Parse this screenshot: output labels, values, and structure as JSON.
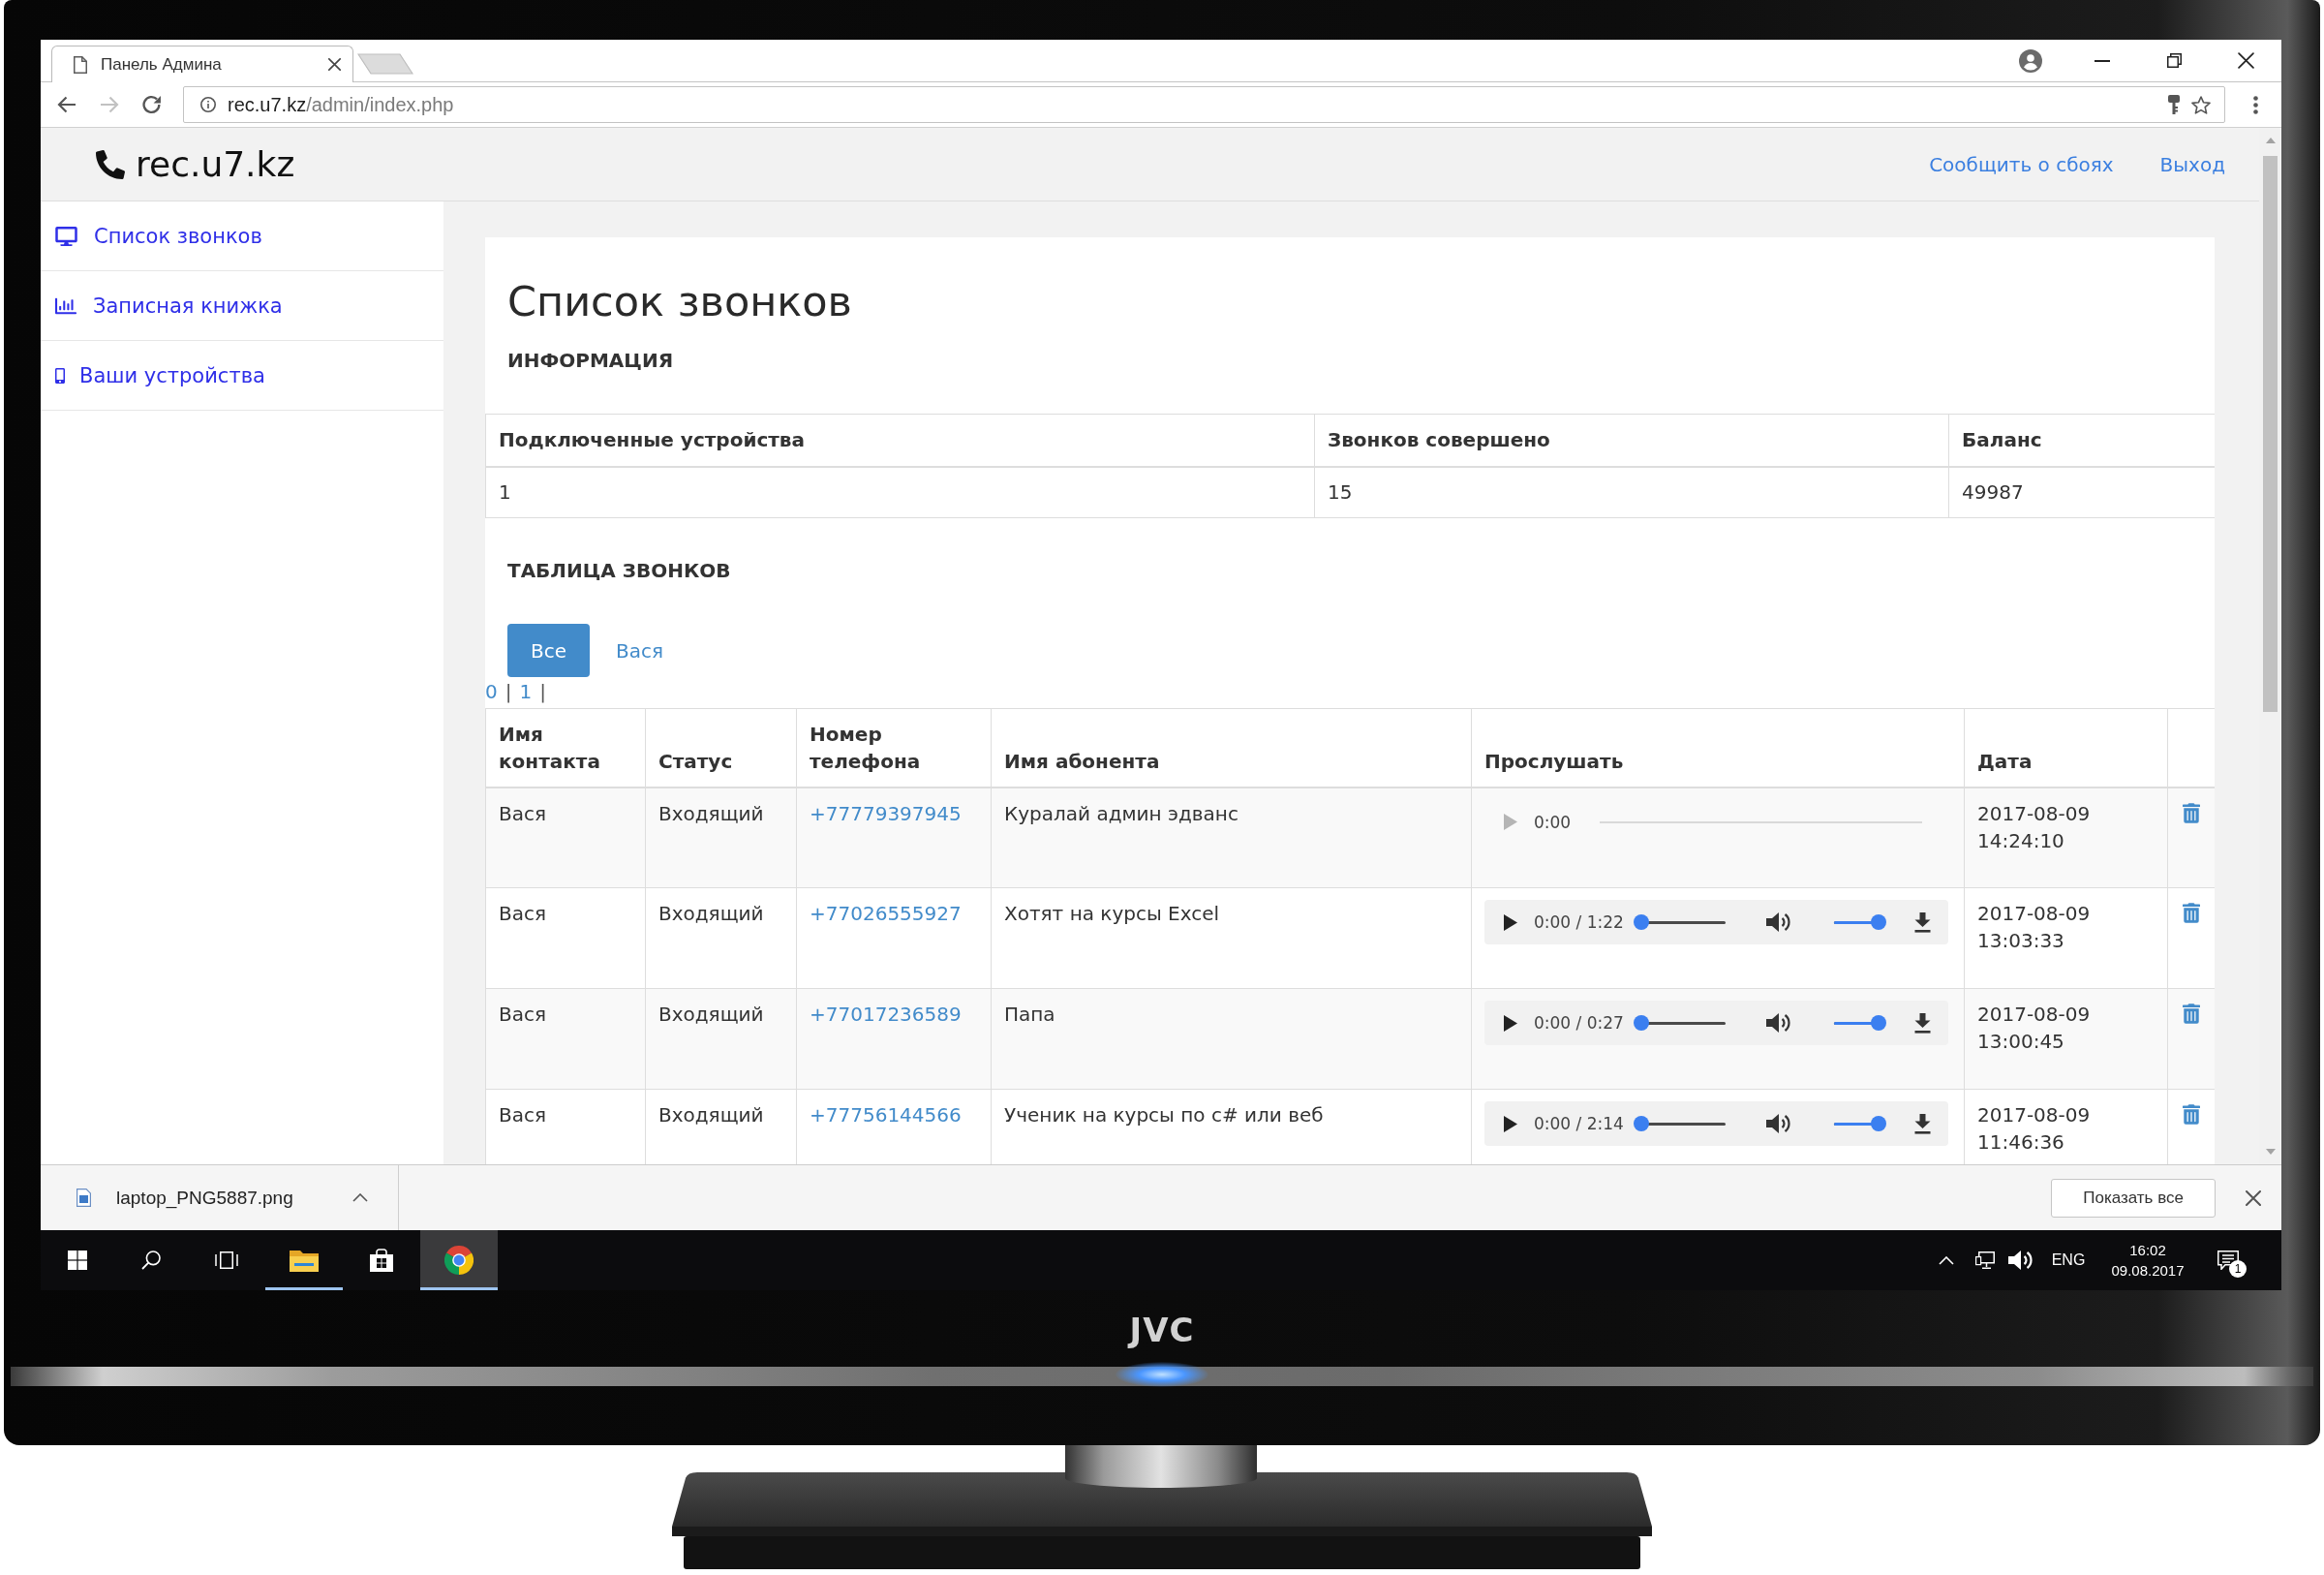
{
  "browser": {
    "tab_title": "Панель Админа",
    "url_host": "rec.u7.kz",
    "url_path": "/admin/index.php",
    "forward_disabled": true
  },
  "header": {
    "logo": "rec.u7.kz",
    "links": [
      "Сообщить о сбоях",
      "Выход"
    ]
  },
  "sidebar": {
    "items": [
      {
        "label": "Список звонков"
      },
      {
        "label": "Записная книжка"
      },
      {
        "label": "Ваши устройства"
      }
    ]
  },
  "page": {
    "title": "Список звонков",
    "info_heading": "ИНФОРМАЦИЯ",
    "info_table": {
      "columns": [
        "Подключенные устройства",
        "Звонков совершено",
        "Баланс"
      ],
      "rows": [
        [
          "1",
          "15",
          "49987"
        ]
      ]
    },
    "calls_heading": "ТАБЛИЦА ЗВОНКОВ",
    "filters": [
      {
        "label": "Все",
        "selected": true
      },
      {
        "label": "Вася",
        "selected": false
      }
    ],
    "pagination": [
      {
        "kind": "page",
        "text": "0"
      },
      {
        "kind": "separator",
        "text": "|"
      },
      {
        "kind": "page",
        "text": "1"
      },
      {
        "kind": "separator",
        "text": "|"
      }
    ],
    "calls_table": {
      "columns": [
        "Имя\nконтакта",
        "Статус",
        "Номер\nтелефона",
        "Имя абонента",
        "Прослушать",
        "Дата"
      ],
      "rows": [
        {
          "contact": "Вася",
          "status": "Входящий",
          "phone": "+77779397945",
          "subscriber": "Куралай админ эдванс",
          "player": {
            "kind": "idle",
            "time": "0:00"
          },
          "date": "2017-08-09",
          "time": "14:24:10"
        },
        {
          "contact": "Вася",
          "status": "Входящий",
          "phone": "+77026555927",
          "subscriber": "Хотят на курсы Excel",
          "player": {
            "kind": "ready",
            "time": "0:00 / 1:22",
            "seek": {
              "level": 0
            },
            "volume": {
              "level": 1
            }
          },
          "date": "2017-08-09",
          "time": "13:03:33"
        },
        {
          "contact": "Вася",
          "status": "Входящий",
          "phone": "+77017236589",
          "subscriber": "Папа",
          "player": {
            "kind": "ready",
            "time": "0:00 / 0:27",
            "seek": {
              "level": 0
            },
            "volume": {
              "level": 1
            }
          },
          "date": "2017-08-09",
          "time": "13:00:45"
        },
        {
          "contact": "Вася",
          "status": "Входящий",
          "phone": "+77756144566",
          "subscriber": "Ученик на курсы по c# или веб",
          "player": {
            "kind": "ready",
            "time": "0:00 / 2:14",
            "seek": {
              "level": 0
            },
            "volume": {
              "level": 1
            }
          },
          "date": "2017-08-09",
          "time": "11:46:36"
        }
      ]
    }
  },
  "download_bar": {
    "filename": "laptop_PNG5887.png",
    "show_all": "Показать все"
  },
  "taskbar": {
    "apps": [
      {
        "open": true,
        "selected": false
      },
      {
        "open": false,
        "selected": false
      },
      {
        "open": true,
        "selected": true
      }
    ],
    "language": "ENG",
    "time": "16:02",
    "date": "09.08.2017",
    "notifications": "1"
  },
  "monitor": {
    "brand": "JVC"
  }
}
